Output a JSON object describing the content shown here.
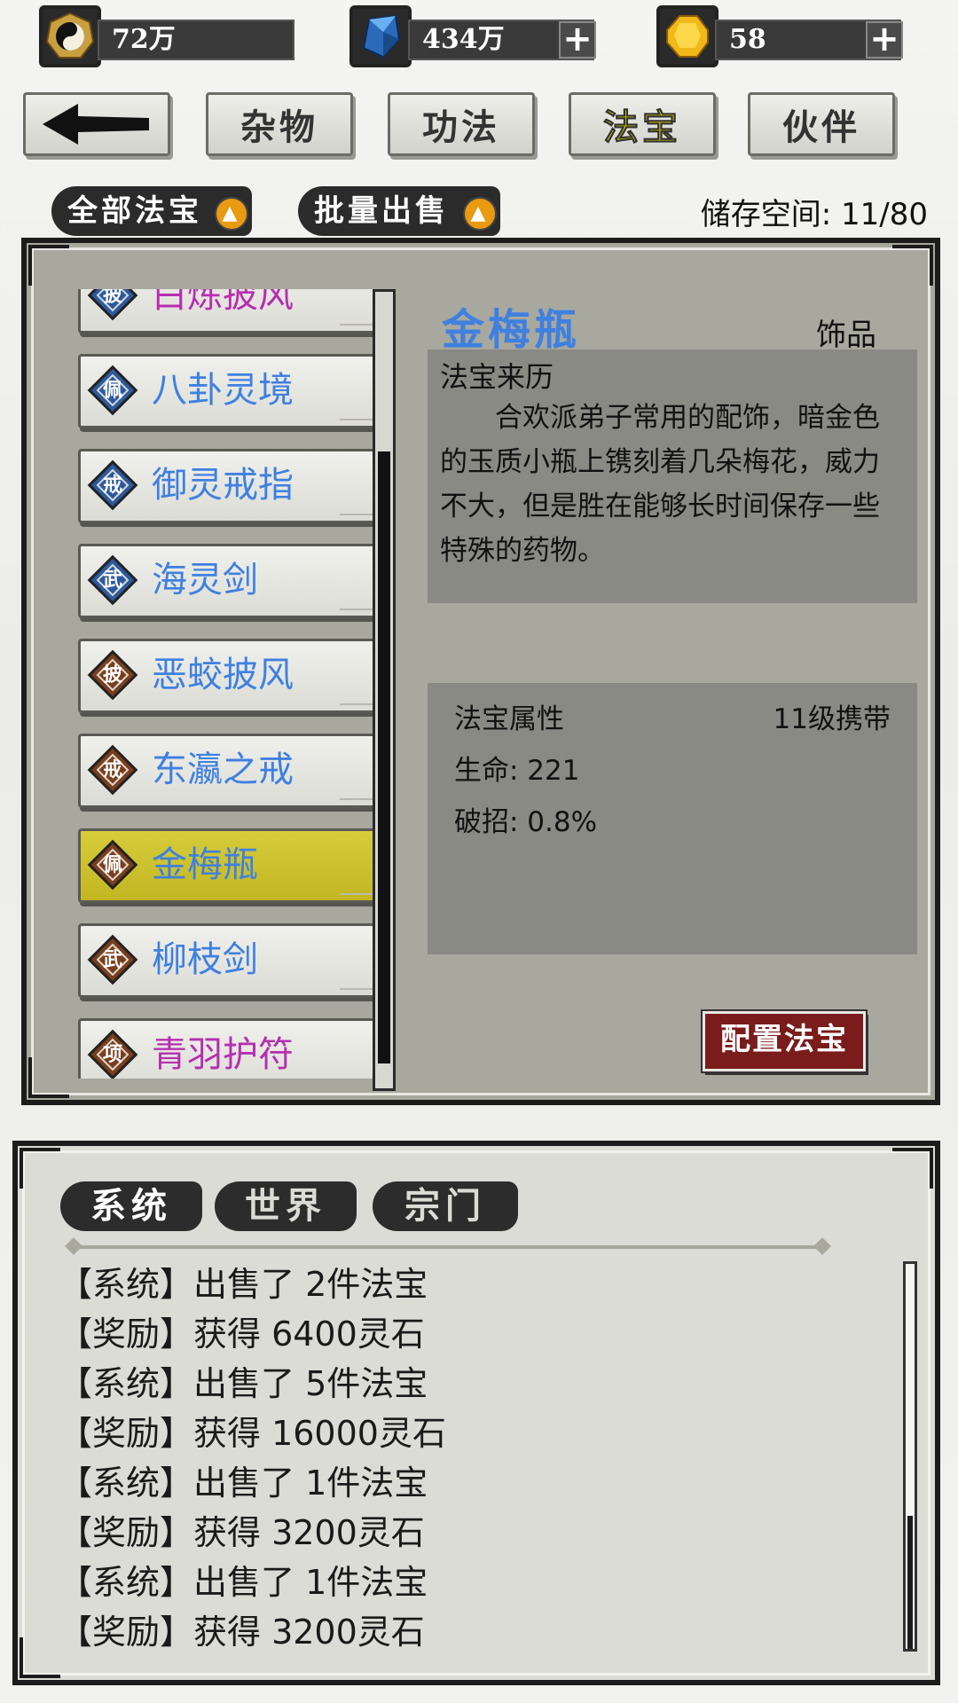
{
  "currencies": [
    {
      "icon": "taiji-icon",
      "value": "72万",
      "has_plus": false
    },
    {
      "icon": "blue-crystal-icon",
      "value": "434万",
      "has_plus": true
    },
    {
      "icon": "gold-gem-icon",
      "value": "58",
      "has_plus": true
    }
  ],
  "tabs": {
    "back_icon": "back-arrow-icon",
    "items": [
      "杂物",
      "功法",
      "法宝",
      "伙伴"
    ],
    "active": "法宝"
  },
  "actions": {
    "filter_label": "全部法宝",
    "bulk_sell_label": "批量出售",
    "storage_text": "储存空间: 11/80"
  },
  "item_list": [
    {
      "badge": "披",
      "name": "白炼披风",
      "name_color": "#b52fb0",
      "badge_color": "#2c5aa0"
    },
    {
      "badge": "佩",
      "name": "八卦灵境",
      "name_color": "#3f80e0",
      "badge_color": "#2c5aa0"
    },
    {
      "badge": "戒",
      "name": "御灵戒指",
      "name_color": "#3f80e0",
      "badge_color": "#2c5aa0"
    },
    {
      "badge": "武",
      "name": "海灵剑",
      "name_color": "#3f80e0",
      "badge_color": "#2c5aa0"
    },
    {
      "badge": "披",
      "name": "恶蛟披风",
      "name_color": "#3f80e0",
      "badge_color": "#7a3e1c"
    },
    {
      "badge": "戒",
      "name": "东瀛之戒",
      "name_color": "#3f80e0",
      "badge_color": "#7a3e1c"
    },
    {
      "badge": "佩",
      "name": "金梅瓶",
      "name_color": "#3f80e0",
      "badge_color": "#7a3e1c",
      "selected": true
    },
    {
      "badge": "武",
      "name": "柳枝剑",
      "name_color": "#3f80e0",
      "badge_color": "#7a3e1c"
    },
    {
      "badge": "项",
      "name": "青羽护符",
      "name_color": "#b52fb0",
      "badge_color": "#7a3e1c"
    }
  ],
  "detail": {
    "name": "金梅瓶",
    "type": "饰品",
    "history_title": "法宝来历",
    "history_text": "合欢派弟子常用的配饰，暗金色的玉质小瓶上镌刻着几朵梅花，威力不大，但是胜在能够长时间保存一些特殊的药物。",
    "attr_title": "法宝属性",
    "attr_level": "11级携带",
    "attrs": [
      "生命: 221",
      "破招: 0.8%"
    ],
    "equip_label": "配置法宝"
  },
  "chat": {
    "tabs": [
      "系统",
      "世界",
      "宗门"
    ],
    "active_tab": "系统",
    "lines": [
      "【系统】出售了 2件法宝",
      "【奖励】获得 6400灵石",
      "【系统】出售了 5件法宝",
      "【奖励】获得 16000灵石",
      "【系统】出售了 1件法宝",
      "【奖励】获得 3200灵石",
      "【系统】出售了 1件法宝",
      "【奖励】获得 3200灵石"
    ]
  }
}
